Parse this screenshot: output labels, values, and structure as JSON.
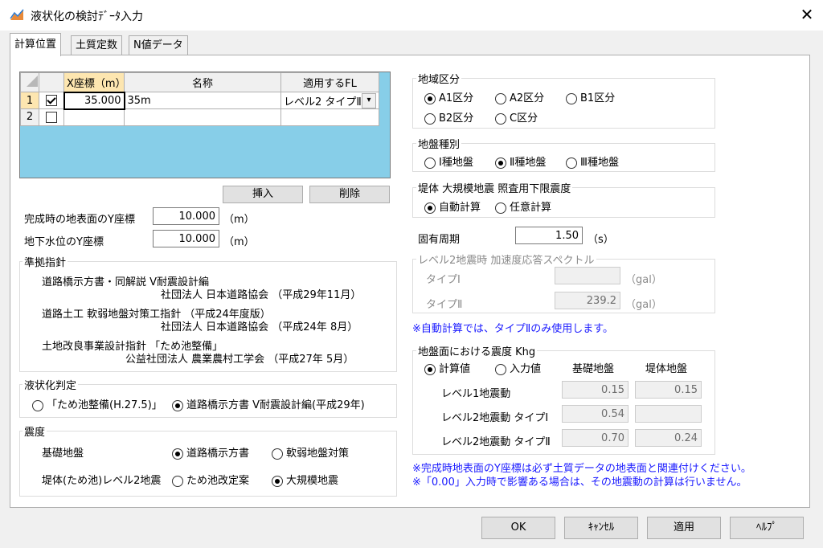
{
  "window": {
    "title": "液状化の検討ﾃﾞｰﾀ入力"
  },
  "tabs": [
    "計算位置",
    "土質定数",
    "N値データ"
  ],
  "grid": {
    "headers": [
      "X座標（m）",
      "名称",
      "適用するFL"
    ],
    "rows": [
      {
        "num": "1",
        "checked": true,
        "x": "35.000",
        "name": "35m",
        "fl": "レベル2 タイプⅡ"
      },
      {
        "num": "2",
        "checked": false,
        "x": "",
        "name": "",
        "fl": ""
      }
    ]
  },
  "buttons": {
    "insert": "挿入",
    "delete": "削除",
    "ok": "OK",
    "cancel": "ｷｬﾝｾﾙ",
    "apply": "適用",
    "help": "ﾍﾙﾌﾟ"
  },
  "fields": {
    "surface_label": "完成時の地表面のY座標",
    "surface_value": "10.000",
    "surface_unit": "（m）",
    "gw_label": "地下水位のY座標",
    "gw_value": "10.000",
    "gw_unit": "（m）"
  },
  "standards": {
    "title": "準拠指針",
    "lines": [
      "道路橋示方書・同解説  Ⅴ耐震設計編",
      "社団法人  日本道路協会 （平成29年11月）",
      "道路土工  軟弱地盤対策工指針 （平成24年度版）",
      "社団法人  日本道路協会 （平成24年  8月）",
      "土地改良事業設計指針 「ため池整備」",
      "公益社団法人  農業農村工学会 （平成27年  5月）"
    ]
  },
  "liquefaction": {
    "title": "液状化判定",
    "opt1": "「ため池整備(H.27.5)」",
    "opt2": "道路橋示方書 Ⅴ耐震設計編(平成29年)"
  },
  "seismic": {
    "title": "震度",
    "row1_label": "基礎地盤",
    "row1_opt1": "道路橋示方書",
    "row1_opt2": "軟弱地盤対策",
    "row2_label": "堤体(ため池)レベル2地震",
    "row2_opt1": "ため池改定案",
    "row2_opt2": "大規模地震"
  },
  "region": {
    "title": "地域区分",
    "options": [
      "A1区分",
      "A2区分",
      "B1区分",
      "B2区分",
      "C区分"
    ]
  },
  "ground_type": {
    "title": "地盤種別",
    "options": [
      "Ⅰ種地盤",
      "Ⅱ種地盤",
      "Ⅲ種地盤"
    ]
  },
  "embankment": {
    "title": "堤体  大規模地震  照査用下限震度",
    "opt1": "自動計算",
    "opt2": "任意計算"
  },
  "period": {
    "label": "固有周期",
    "value": "1.50",
    "unit": "（s）"
  },
  "spectrum": {
    "title": "レベル2地震時  加速度応答スペクトル",
    "type1_label": "タイプⅠ",
    "type1_value": "",
    "type1_unit": "（gal）",
    "type2_label": "タイプⅡ",
    "type2_value": "239.2",
    "type2_unit": "（gal）"
  },
  "note_auto": "※自動計算では、タイプⅡのみ使用します。",
  "khg": {
    "title": "地盤面における震度 Khg",
    "opt1": "計算値",
    "opt2": "入力値",
    "col1": "基礎地盤",
    "col2": "堤体地盤",
    "rows": [
      {
        "label": "レベル1地震動",
        "v1": "0.15",
        "v2": "0.15"
      },
      {
        "label": "レベル2地震動 タイプⅠ",
        "v1": "0.54",
        "v2": ""
      },
      {
        "label": "レベル2地震動 タイプⅡ",
        "v1": "0.70",
        "v2": "0.24"
      }
    ]
  },
  "notes": [
    "※完成時地表面のY座標は必ず土質データの地表面と関連付けください。",
    "※「0.00」入力時で影響ある場合は、その地震動の計算は行いません。"
  ],
  "colors": {
    "grid_bg": "#87cee8",
    "note": "#1a1aff",
    "active_cell": "#000000"
  }
}
